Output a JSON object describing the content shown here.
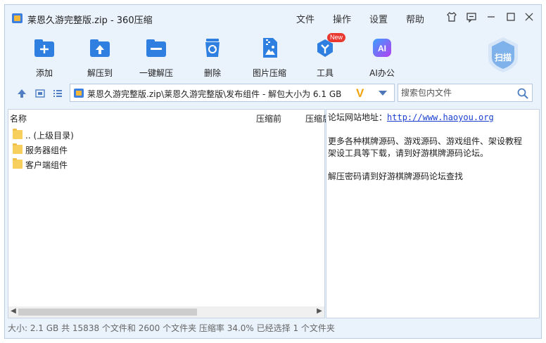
{
  "window": {
    "title": "莱恩久游完整版.zip - 360压缩"
  },
  "menu": {
    "file": "文件",
    "operation": "操作",
    "settings": "设置",
    "help": "帮助"
  },
  "toolbar": {
    "add": "添加",
    "extract_to": "解压到",
    "one_click_extract": "一键解压",
    "delete": "删除",
    "image_compress": "图片压缩",
    "tools": "工具",
    "tools_badge": "New",
    "ai_office": "AI办公",
    "ai_icon_text": "AI",
    "scan": "扫描"
  },
  "address": {
    "path": "莱恩久游完整版.zip\\莱恩久游完整版\\发布组件 - 解包大小为 6.1 GB",
    "brand_mark": "V"
  },
  "search": {
    "placeholder": "搜索包内文件"
  },
  "filelist": {
    "columns": {
      "name": "名称",
      "compressed_before": "压缩前",
      "compressed_after": "压缩后"
    },
    "rows": [
      {
        "name": ".. (上级目录)"
      },
      {
        "name": "服务器组件"
      },
      {
        "name": "客户端组件"
      }
    ]
  },
  "comment": {
    "line1_label": "论坛网站地址：",
    "line1_url": "http://www.haoyou.org",
    "line2": "更多各种棋牌源码、游戏源码、游戏组件、架设教程",
    "line3": "架设工具等下载，请到好游棋牌源码论坛。",
    "line4": "解压密码请到好游棋牌源码论坛查找"
  },
  "status": {
    "text": "大小: 2.1 GB 共 15838 个文件和 2600 个文件夹 压缩率 34.0% 已经选择 1 个文件夹"
  },
  "colors": {
    "accent_blue": "#2f7fe0",
    "window_bg": "#eaf2fc",
    "link": "#1a3fd0",
    "badge_red": "#e8382f"
  }
}
